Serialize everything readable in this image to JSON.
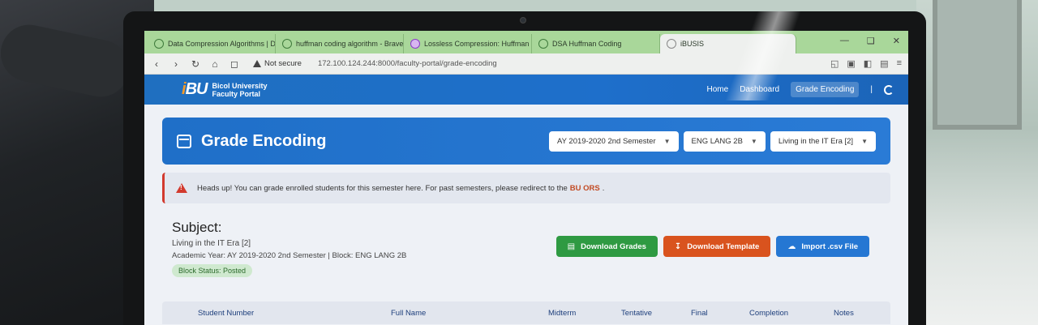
{
  "browser": {
    "tabs": [
      {
        "label": "Data Compression Algorithms | Drei",
        "active": false
      },
      {
        "label": "huffman coding algorithm - Brave Se",
        "active": false
      },
      {
        "label": "Lossless Compression: Huffman Cod",
        "active": false
      },
      {
        "label": "DSA Huffman Coding",
        "active": false
      },
      {
        "label": "iBUSIS",
        "active": true
      }
    ],
    "security_label": "Not secure",
    "url": "172.100.124.244:8000/faculty-portal/grade-encoding"
  },
  "header": {
    "logo_mark_i": "i",
    "logo_mark_bu": "BU",
    "logo_line1": "Bicol University",
    "logo_line2": "Faculty Portal",
    "nav": {
      "home": "Home",
      "dashboard": "Dashboard",
      "grade_encoding": "Grade Encoding",
      "separator": "|"
    }
  },
  "banner": {
    "title": "Grade Encoding",
    "semester_select": "AY 2019-2020 2nd Semester",
    "block_select": "ENG LANG 2B",
    "subject_select": "Living in the IT Era [2]"
  },
  "alert": {
    "text_before": "Heads up! You can grade enrolled students for this semester here. For past semesters, please redirect to the",
    "link": "BU ORS",
    "text_after": "."
  },
  "subject": {
    "heading": "Subject:",
    "name": "Living in the IT Era [2]",
    "meta": "Academic Year: AY 2019-2020 2nd Semester | Block: ENG LANG 2B",
    "block_status": "Block Status: Posted"
  },
  "actions": {
    "download_grades": "Download Grades",
    "download_template": "Download Template",
    "import_csv": "Import .csv File"
  },
  "table": {
    "columns": [
      "Student Number",
      "Full Name",
      "Midterm",
      "Tentative",
      "Final",
      "Completion",
      "Notes"
    ]
  }
}
